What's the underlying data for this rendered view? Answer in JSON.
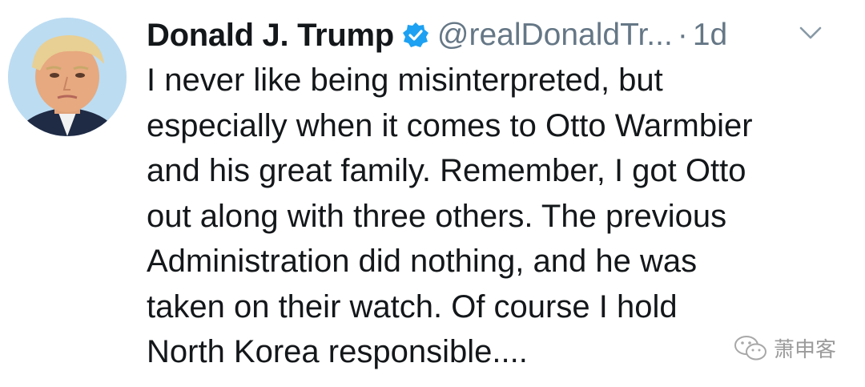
{
  "tweet": {
    "display_name": "Donald J. Trump",
    "handle": "@realDonaldTr...",
    "separator": "·",
    "time": "1d",
    "verified_icon": "verified-badge-icon",
    "caret_icon": "chevron-down-icon",
    "text": "I never like being misinterpreted, but\nespecially when it comes to Otto Warmbier\nand his great family. Remember, I got Otto\nout along with three others. The previous\nAdministration did nothing, and he was\ntaken on their watch. Of course I hold\nNorth Korea responsible...."
  },
  "watermark": {
    "icon": "wechat-logo-icon",
    "text": "萧申客"
  },
  "colors": {
    "text": "#14171a",
    "secondary": "#657786",
    "verified": "#1da1f2",
    "background": "#ffffff"
  }
}
